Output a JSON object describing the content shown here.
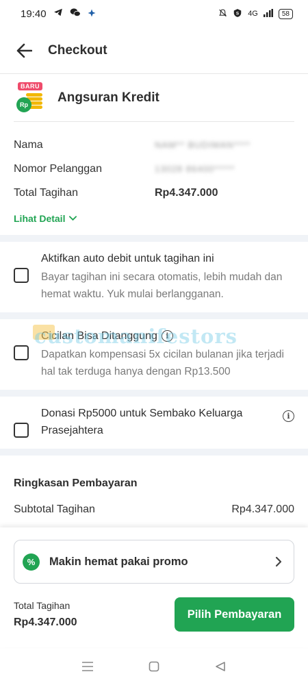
{
  "status_bar": {
    "time": "19:40",
    "signal": "4G",
    "battery": "58"
  },
  "header": {
    "title": "Checkout"
  },
  "product": {
    "badge": "BARU",
    "coin_label": "Rp",
    "name": "Angsuran Kredit"
  },
  "details": [
    {
      "label": "Nama",
      "value": "NAM** BUDIMAN****"
    },
    {
      "label": "Nomor Pelanggan",
      "value": "13028 86400*****"
    },
    {
      "label": "Total Tagihan",
      "value": "Rp4.347.000"
    }
  ],
  "lihat_detail": "Lihat Detail",
  "options": {
    "auto_debit": {
      "title": "Aktifkan auto debit untuk tagihan ini",
      "description": "Bayar tagihan ini secara otomatis, lebih mudah dan hemat waktu. Yuk mulai berlangganan."
    },
    "cicilan": {
      "title": "Cicilan Bisa Ditanggung",
      "description": "Dapatkan kompensasi 5x cicilan bulanan jika terjadi hal tak terduga hanya dengan Rp13.500",
      "watermark": "customanifestors"
    },
    "donasi": {
      "title": "Donasi Rp5000 untuk Sembako Keluarga Prasejahtera"
    }
  },
  "summary": {
    "title": "Ringkasan Pembayaran",
    "subtotal_label": "Subtotal Tagihan",
    "subtotal_value": "Rp4.347.000"
  },
  "promo": {
    "icon_label": "%",
    "text": "Makin hemat pakai promo"
  },
  "footer": {
    "total_label": "Total Tagihan",
    "total_value": "Rp4.347.000",
    "pay_button": "Pilih Pembayaran"
  },
  "colors": {
    "primary_green": "#21a453",
    "badge_pink": "#ef4b6b",
    "coin_gold": "#f2b807"
  }
}
